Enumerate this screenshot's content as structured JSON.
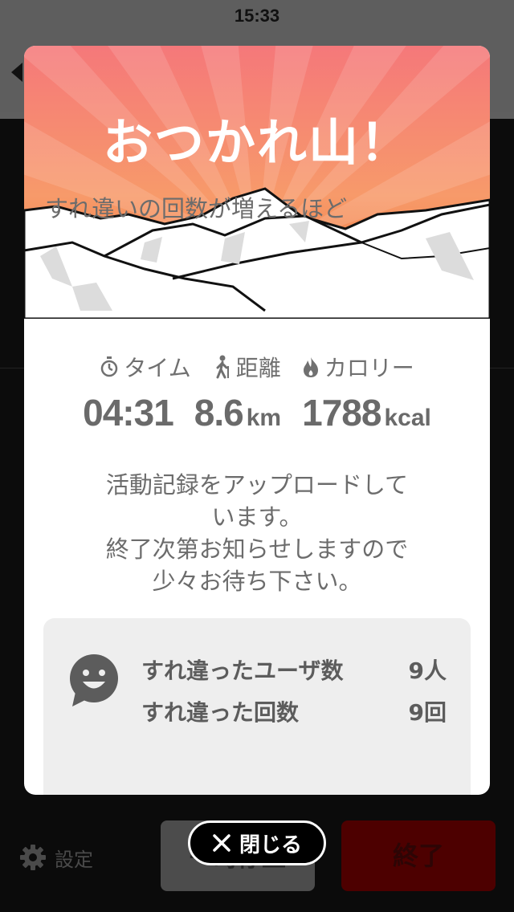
{
  "status_bar": {
    "time": "15:33"
  },
  "modal": {
    "title": "おつかれ山！",
    "stats": [
      {
        "label": "タイム",
        "value": "04:31",
        "unit": "",
        "icon": "stopwatch-icon"
      },
      {
        "label": "距離",
        "value": "8.6",
        "unit": "km",
        "icon": "hiker-icon"
      },
      {
        "label": "カロリー",
        "value": "1788",
        "unit": "kcal",
        "icon": "flame-icon"
      }
    ],
    "upload_message": [
      "活動記録をアップロードして",
      "います。",
      "終了次第お知らせしますので",
      "少々お待ち下さい。"
    ],
    "encounters": {
      "users_label": "すれ違ったユーザ数",
      "users_value": "9人",
      "count_label": "すれ違った回数",
      "count_value": "9回",
      "note": "すれ違いの回数が増えるほど"
    },
    "close_label": "閉じる"
  },
  "bottom_bar": {
    "settings_label": "設定",
    "pause_label": "一時停止",
    "end_label": "終了"
  },
  "colors": {
    "sunburst_top": "#f5787a",
    "sunburst_bottom": "#f07a3a",
    "end_button": "#4d0000"
  }
}
